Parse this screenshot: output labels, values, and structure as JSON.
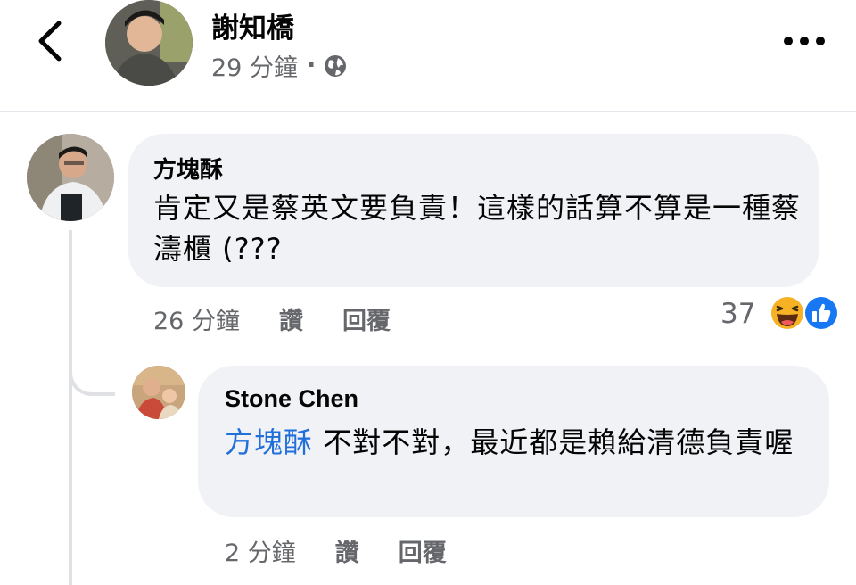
{
  "header": {
    "author_name": "謝知橋",
    "timestamp": "29 分鐘",
    "separator": "·",
    "privacy_icon": "globe-icon",
    "back_icon": "chevron-left-icon",
    "more_icon": "more-horizontal-icon"
  },
  "comments": [
    {
      "author": "方塊酥",
      "text": "肯定又是蔡英文要負責！這樣的話算不算是一種蔡濤櫃 (???",
      "time": "26 分鐘",
      "like_label": "讚",
      "reply_label": "回覆",
      "reaction_count": "37",
      "reactions": [
        "haha-icon",
        "like-icon"
      ],
      "replies": [
        {
          "author": "Stone Chen",
          "mention": "方塊酥",
          "text": " 不對不對，最近都是賴給清德負責喔",
          "time": "2 分鐘",
          "like_label": "讚",
          "reply_label": "回覆"
        }
      ]
    }
  ],
  "colors": {
    "bubble": "#f0f2f5",
    "meta_text": "#65676b",
    "mention": "#216fdb",
    "like_blue": "#1877f2",
    "haha_yellow": "#f7b125"
  }
}
